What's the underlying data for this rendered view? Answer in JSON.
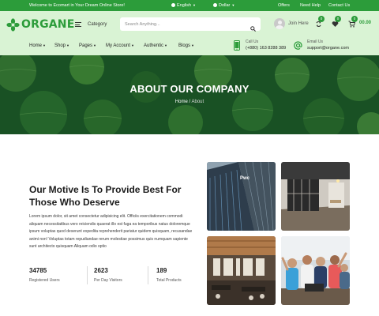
{
  "topbar": {
    "welcome": "Welcome to Ecomart in Your Dream Online Store!",
    "language": "English",
    "currency": "Dollar",
    "links": [
      "Offers",
      "Need Help",
      "Contact Us"
    ]
  },
  "header": {
    "logo_text": "ORGANE",
    "category_label": "Category",
    "search_placeholder": "Search Anything...",
    "join_label": "Join Here",
    "compare_count": "0",
    "wishlist_count": "0",
    "cart_count": "0",
    "cart_total": "00.00"
  },
  "nav": {
    "items": [
      {
        "label": "Home"
      },
      {
        "label": "Shop"
      },
      {
        "label": "Pages"
      },
      {
        "label": "My Account"
      },
      {
        "label": "Authentic"
      },
      {
        "label": "Blogs"
      }
    ],
    "call_label": "Call Us",
    "call_value": "(+880) 163 8288 389",
    "email_label": "Email Us",
    "email_value": "support@organe.com"
  },
  "hero": {
    "title": "ABOUT OUR COMPANY",
    "breadcrumb_home": "Home",
    "breadcrumb_separator": "/",
    "breadcrumb_current": "About"
  },
  "motive": {
    "heading_line1": "Our Motive Is To Provide Best For",
    "heading_line2": "Those Who Deserve",
    "paragraph": "Lorem ipsum dolor, sit amet consectetur adipisicing elit. Officiis exercitationem commodi aliquam necessitatibus vero reiciendis quaerat illo est fuga ea temporibus natus doloremque ipsum voluptas quod deserunt expedita reprehenderit pariatur quidem quisquam, recusandae animi non! Voluptas totam repudiandae rerum molestiae possimus quis numquam sapiente sunt architecto quisquam Aliquam odio optio",
    "stats": [
      {
        "number": "34785",
        "label": "Registered Users"
      },
      {
        "number": "2623",
        "label": "Per Day Visitors"
      },
      {
        "number": "189",
        "label": "Total Products"
      }
    ]
  },
  "gallery": {
    "building_sign": "Pwc"
  },
  "colors": {
    "brand_green": "#2c9c3a",
    "header_bg": "#d9f3d4",
    "hero_bg": "#1f6a2d"
  },
  "icons": [
    "leaf-logo-icon",
    "menu-icon",
    "search-icon",
    "user-avatar-icon",
    "compare-icon",
    "heart-icon",
    "cart-icon",
    "phone-icon",
    "at-sign-icon",
    "globe-icon",
    "dollar-icon"
  ]
}
